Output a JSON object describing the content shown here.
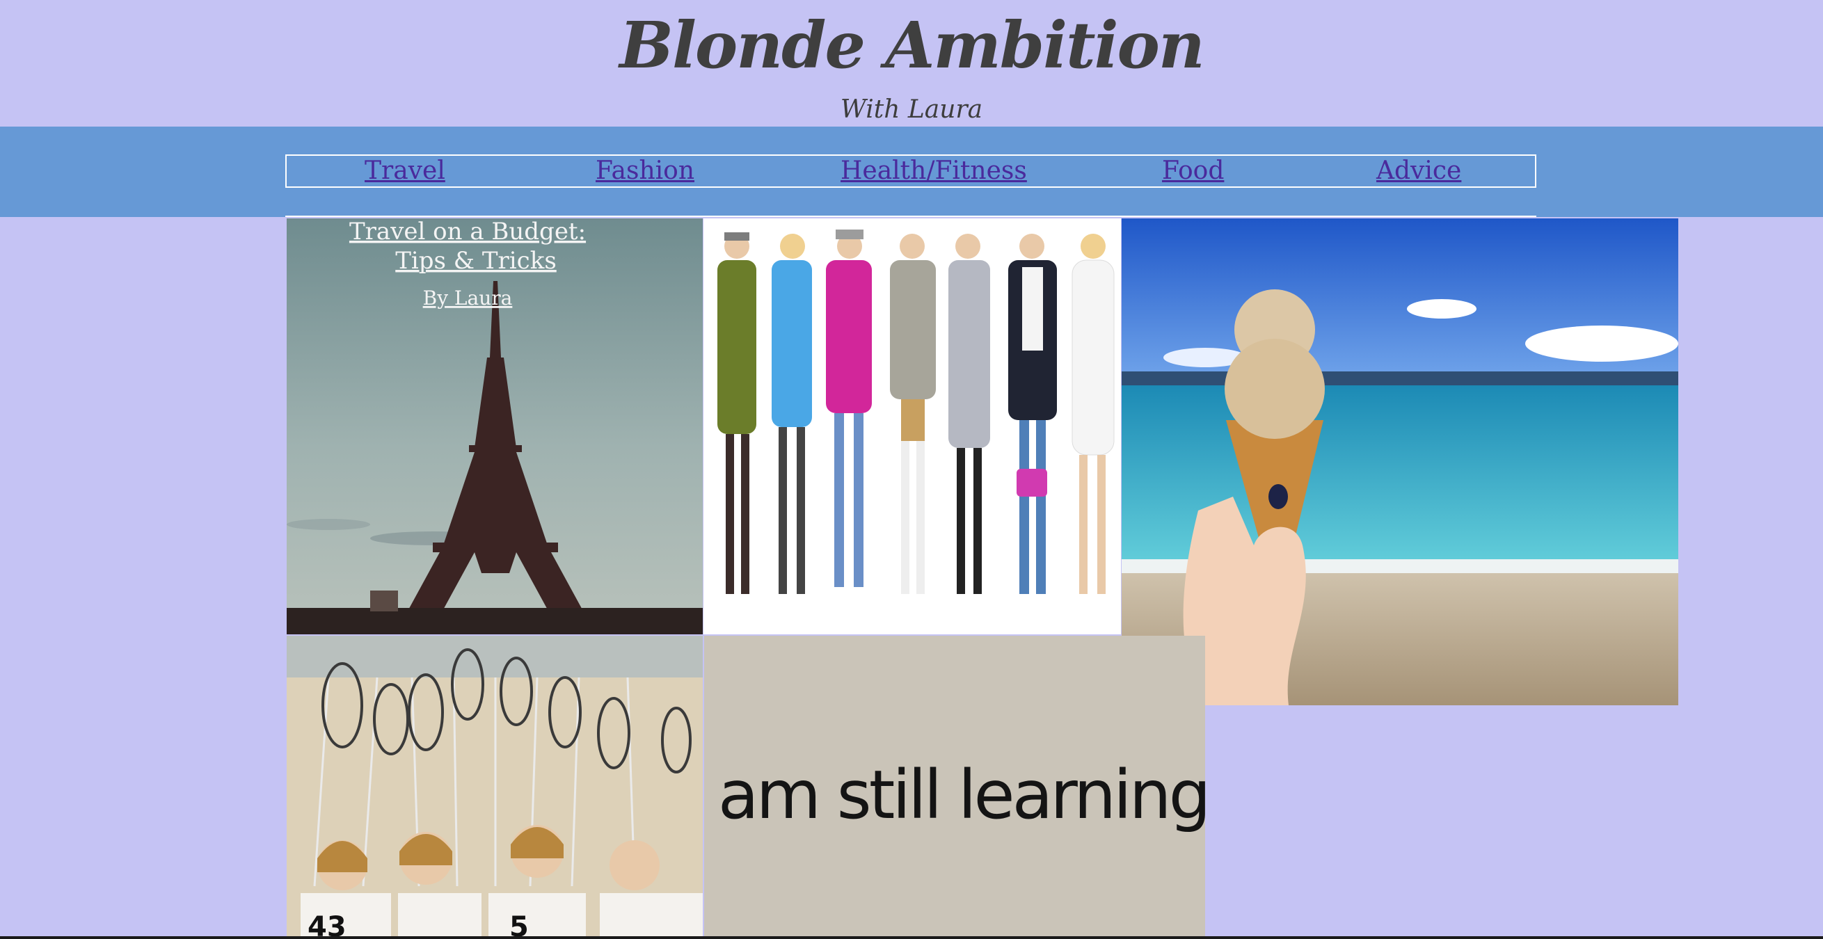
{
  "header": {
    "title": "Blonde Ambition",
    "subtitle": "With Laura"
  },
  "nav": {
    "items": [
      {
        "label": "Travel"
      },
      {
        "label": "Fashion"
      },
      {
        "label": "Health/Fitness"
      },
      {
        "label": "Food"
      },
      {
        "label": "Advice"
      }
    ]
  },
  "tiles": {
    "travel": {
      "line1": "Travel on a Budget:",
      "line2": "Tips & Tricks",
      "byline": "By Laura"
    },
    "advice": {
      "quote": "”I am still learning.”"
    },
    "lacrosse": {
      "jersey1": "43",
      "jersey2": "5"
    }
  },
  "colors": {
    "page_background": "#c5c3f4",
    "nav_background": "#6699d6",
    "link": "#4a2a9c",
    "title": "#3f3f3f"
  }
}
